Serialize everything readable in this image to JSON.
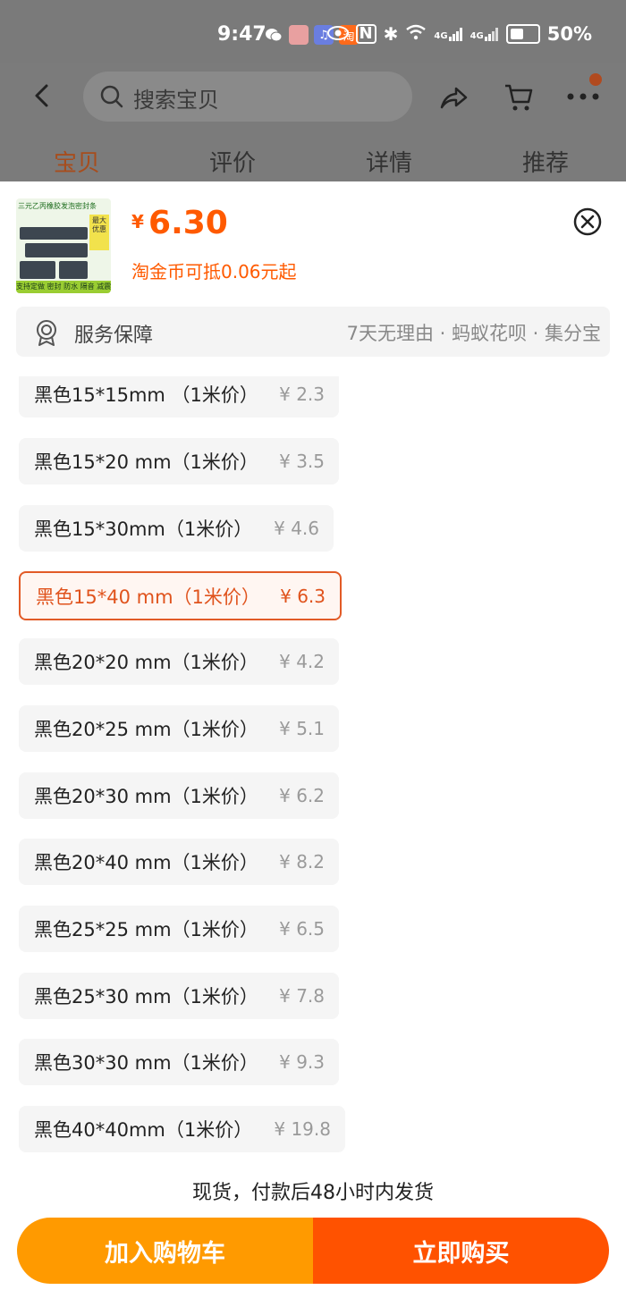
{
  "status_bar": {
    "time": "9:47",
    "battery": "50%",
    "net1": "4G",
    "net2": "4G"
  },
  "nav": {
    "search_placeholder": "搜索宝贝"
  },
  "tabs": [
    {
      "label": "宝贝"
    },
    {
      "label": "评价"
    },
    {
      "label": "详情"
    },
    {
      "label": "推荐"
    }
  ],
  "product": {
    "thumb_title": "三元乙丙橡胶发泡密封条",
    "thumb_tag": "最大优惠",
    "thumb_bottom": "支持定做 密封 防水 隔音 减震",
    "currency": "¥",
    "price": "6.30",
    "coin_note": "淘金币可抵0.06元起"
  },
  "service": {
    "title": "服务保障",
    "detail": "7天无理由 · 蚂蚁花呗 · 集分宝"
  },
  "options": [
    {
      "label": "黑色15*15mm （1米价）",
      "price": "¥ 2.3"
    },
    {
      "label": "黑色15*20 mm（1米价）",
      "price": "¥ 3.5"
    },
    {
      "label": "黑色15*30mm（1米价）",
      "price": "¥ 4.6"
    },
    {
      "label": "黑色15*40 mm（1米价）",
      "price": "¥ 6.3"
    },
    {
      "label": "黑色20*20 mm（1米价）",
      "price": "¥ 4.2"
    },
    {
      "label": "黑色20*25 mm（1米价）",
      "price": "¥ 5.1"
    },
    {
      "label": "黑色20*30 mm（1米价）",
      "price": "¥ 6.2"
    },
    {
      "label": "黑色20*40 mm（1米价）",
      "price": "¥ 8.2"
    },
    {
      "label": "黑色25*25 mm（1米价）",
      "price": "¥ 6.5"
    },
    {
      "label": "黑色25*30 mm（1米价）",
      "price": "¥ 7.8"
    },
    {
      "label": "黑色30*30 mm（1米价）",
      "price": "¥ 9.3"
    },
    {
      "label": "黑色40*40mm（1米价）",
      "price": "¥ 19.8"
    }
  ],
  "shipping_note": "现货，付款后48小时内发货",
  "actions": {
    "add_to_cart": "加入购物车",
    "buy_now": "立即购买"
  },
  "colors": {
    "accent": "#ff5a00",
    "cart_button": "#ff9a00",
    "buy_button": "#ff5200"
  }
}
